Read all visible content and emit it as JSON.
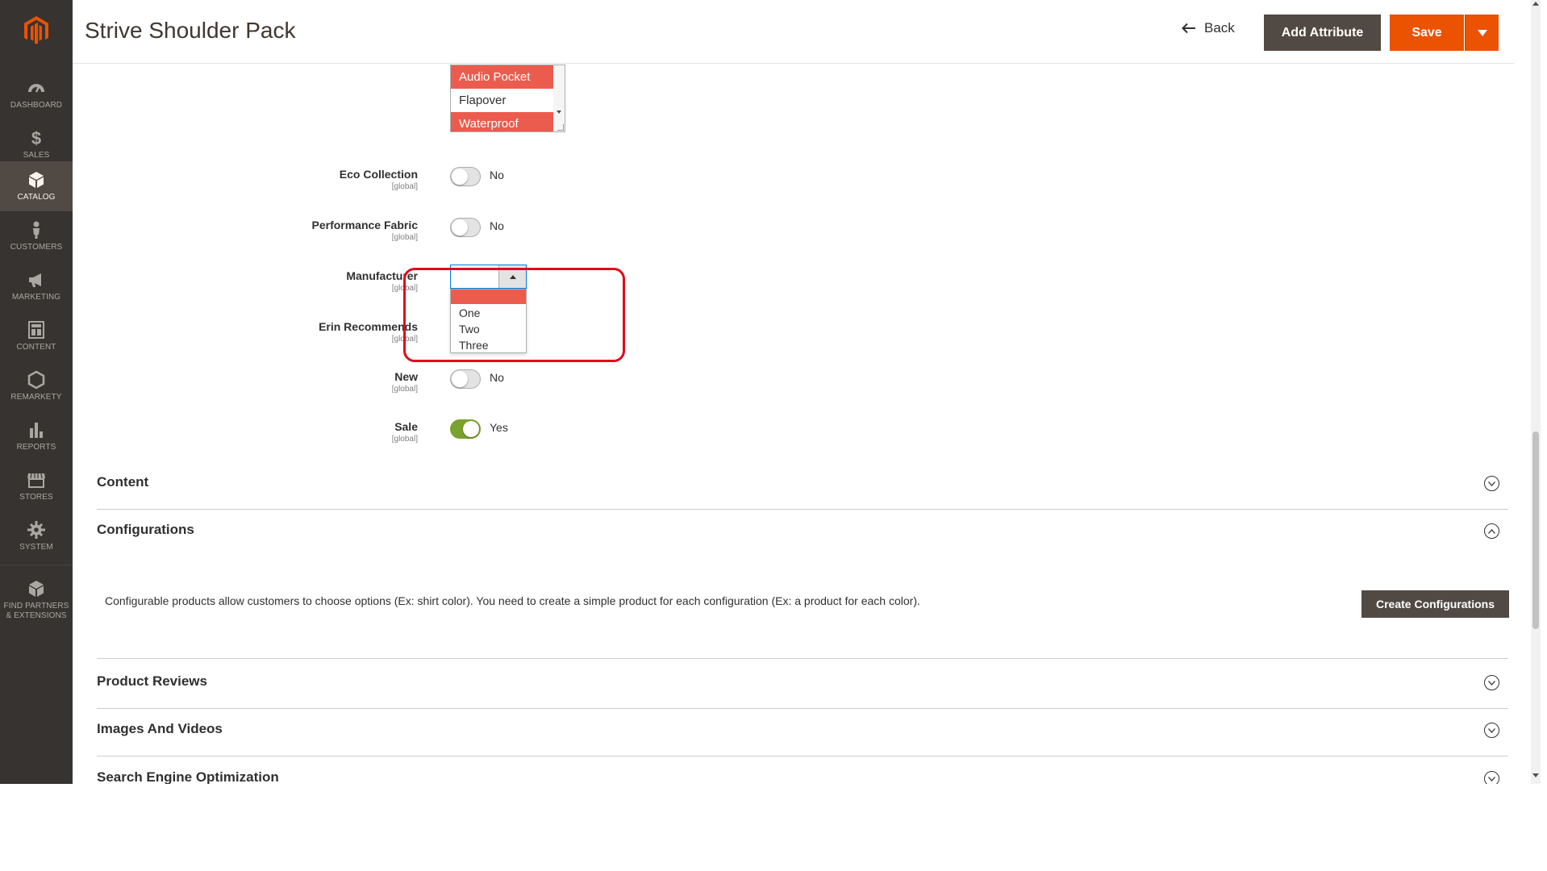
{
  "window": {
    "title": "Strive Shoulder Pack"
  },
  "header": {
    "back_label": "Back",
    "add_attribute_label": "Add Attribute",
    "save_label": "Save"
  },
  "sidebar": {
    "items": [
      {
        "label": "DASHBOARD",
        "icon": "dashboard-icon"
      },
      {
        "label": "SALES",
        "icon": "dollar-icon"
      },
      {
        "label": "CATALOG",
        "icon": "box-icon",
        "active": true
      },
      {
        "label": "CUSTOMERS",
        "icon": "person-icon"
      },
      {
        "label": "MARKETING",
        "icon": "megaphone-icon"
      },
      {
        "label": "CONTENT",
        "icon": "layout-icon"
      },
      {
        "label": "REMARKETY",
        "icon": "hexagon-icon"
      },
      {
        "label": "REPORTS",
        "icon": "bar-chart-icon"
      },
      {
        "label": "STORES",
        "icon": "store-icon"
      },
      {
        "label": "SYSTEM",
        "icon": "gear-icon"
      },
      {
        "label": "FIND PARTNERS & EXTENSIONS",
        "icon": "partners-box-icon"
      }
    ]
  },
  "features_multiselect": {
    "options": [
      {
        "label": "Audio Pocket",
        "selected": true
      },
      {
        "label": "Flapover",
        "selected": false
      },
      {
        "label": "Waterproof",
        "selected": true
      }
    ]
  },
  "fields": {
    "eco_collection": {
      "label": "Eco Collection",
      "scope": "[global]",
      "value": "No"
    },
    "performance_fabric": {
      "label": "Performance Fabric",
      "scope": "[global]",
      "value": "No"
    },
    "manufacturer": {
      "label": "Manufacturer",
      "scope": "[global]",
      "value": "",
      "options": [
        "",
        "One",
        "Two",
        "Three"
      ]
    },
    "erin_recommends": {
      "label": "Erin Recommends",
      "scope": "[global]"
    },
    "new": {
      "label": "New",
      "scope": "[global]",
      "value": "No"
    },
    "sale": {
      "label": "Sale",
      "scope": "[global]",
      "value": "Yes"
    }
  },
  "sections": {
    "content": {
      "title": "Content"
    },
    "configurations": {
      "title": "Configurations",
      "description": "Configurable products allow customers to choose options (Ex: shirt color). You need to create a simple product for each configuration (Ex: a product for each color).",
      "button_label": "Create Configurations"
    },
    "product_reviews": {
      "title": "Product Reviews"
    },
    "images_videos": {
      "title": "Images And Videos"
    },
    "seo": {
      "title": "Search Engine Optimization"
    }
  },
  "colors": {
    "accent": "#eb5202",
    "sidebar_bg": "#373330",
    "dark_button": "#514943",
    "selected_option": "#eb5c4e",
    "toggle_on": "#79a22e",
    "annotation_ring": "#e00b1c"
  }
}
